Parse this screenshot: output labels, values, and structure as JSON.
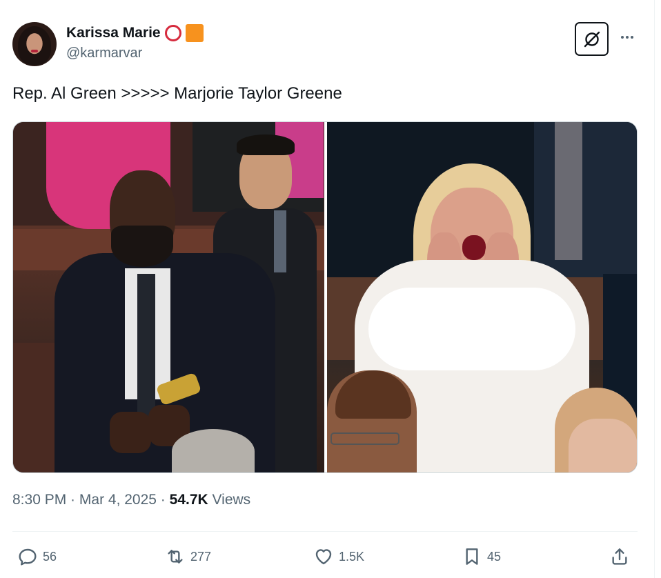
{
  "author": {
    "name": "Karissa Marie",
    "handle": "@karmarvar",
    "badges": [
      "red-ring-icon",
      "orange-square-icon"
    ]
  },
  "tweet": {
    "text": "Rep. Al Green >>>>> Marjorie Taylor Greene"
  },
  "meta": {
    "time": "8:30 PM",
    "separator1": " · ",
    "date": "Mar 4, 2025",
    "separator2": " · ",
    "views_count": "54.7K",
    "views_label": " Views"
  },
  "actions": {
    "replies": "56",
    "reposts": "277",
    "likes": "1.5K",
    "bookmarks": "45"
  },
  "icons": {
    "grok": "grok-icon",
    "more": "more-icon",
    "reply": "reply-icon",
    "repost": "repost-icon",
    "like": "heart-icon",
    "bookmark": "bookmark-icon",
    "share": "share-icon"
  },
  "colors": {
    "text_primary": "#0f1419",
    "text_secondary": "#536471",
    "badge_ring": "#d62b3e",
    "badge_square": "#f7921e"
  }
}
